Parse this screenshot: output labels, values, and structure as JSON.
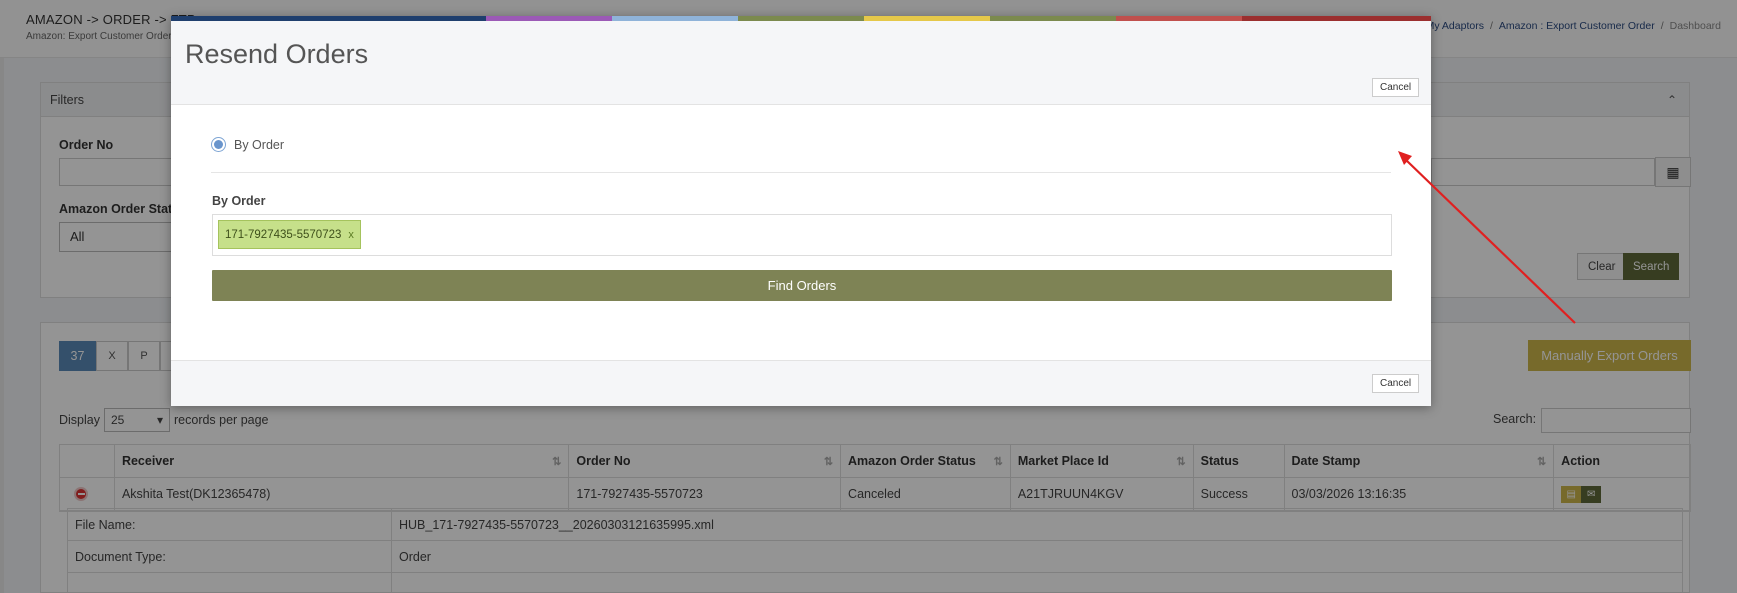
{
  "header": {
    "title": "AMAZON -> ORDER -> FTP",
    "subtitle": "Amazon: Export Customer Order",
    "breadcrumb": [
      "My Adaptors",
      "Amazon : Export Customer Order",
      "Dashboard"
    ]
  },
  "filters": {
    "heading": "Filters",
    "order_no_label": "Order No",
    "status_label": "Amazon Order Status",
    "status_value": "All",
    "clear_label": "Clear",
    "search_label": "Search"
  },
  "list": {
    "count": "37",
    "manual_export_label": "Manually Export Orders",
    "display_label": "Display",
    "per_page_value": "25",
    "records_label": "records per page",
    "search_label": "Search:",
    "columns": [
      "Receiver",
      "Order No",
      "Amazon Order Status",
      "Market Place Id",
      "Status",
      "Date Stamp",
      "Action"
    ],
    "rows": [
      {
        "receiver": "Akshita Test(DK12365478)",
        "order_no": "171-7927435-5570723",
        "amazon_status": "Canceled",
        "marketplace_id": "A21TJRUUN4KGV",
        "status": "Success",
        "date_stamp": "03/03/2026 13:16:35"
      }
    ],
    "detail": [
      {
        "key": "File Name:",
        "value": "HUB_171-7927435-5570723__20260303121635995.xml"
      },
      {
        "key": "Document Type:",
        "value": "Order"
      }
    ]
  },
  "modal": {
    "title": "Resend Orders",
    "cancel_label": "Cancel",
    "radio_label": "By Order",
    "field_label": "By Order",
    "tag_value": "171-7927435-5570723",
    "tag_remove": "x",
    "find_label": "Find Orders",
    "strip_colors": [
      "#1f3f6e",
      "#9b59b6",
      "#8fb3d9",
      "#7b8a4e",
      "#e5c84a",
      "#7b8a4e",
      "#c0504d",
      "#9b2f2f"
    ]
  },
  "annotation": {
    "arrow_color": "#e02020"
  }
}
